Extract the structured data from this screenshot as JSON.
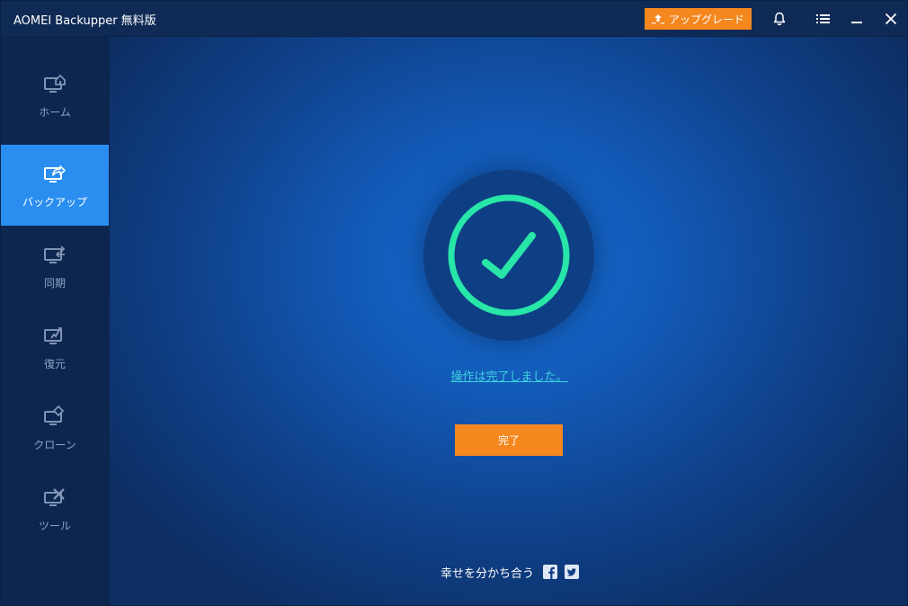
{
  "window": {
    "title": "AOMEI Backupper 無料版"
  },
  "titlebar": {
    "upgrade_label": "アップグレード",
    "icons": [
      "bell-icon",
      "menu-icon",
      "minimize-icon",
      "close-icon"
    ]
  },
  "sidebar": {
    "items": [
      {
        "label": "ホーム",
        "icon": "home-monitor-icon",
        "active": false
      },
      {
        "label": "バックアップ",
        "icon": "backup-monitor-icon",
        "active": true
      },
      {
        "label": "同期",
        "icon": "sync-monitor-icon",
        "active": false
      },
      {
        "label": "復元",
        "icon": "restore-monitor-icon",
        "active": false
      },
      {
        "label": "クローン",
        "icon": "clone-monitor-icon",
        "active": false
      },
      {
        "label": "ツール",
        "icon": "tools-monitor-icon",
        "active": false
      }
    ]
  },
  "main": {
    "status_text": "操作は完了しました。",
    "done_label": "完了",
    "share_label": "幸せを分かち合う"
  },
  "colors": {
    "accent_orange": "#f5871f",
    "active_nav": "#2a8ef0",
    "success_green": "#27e6a8",
    "link_cyan": "#3ed1e0"
  }
}
